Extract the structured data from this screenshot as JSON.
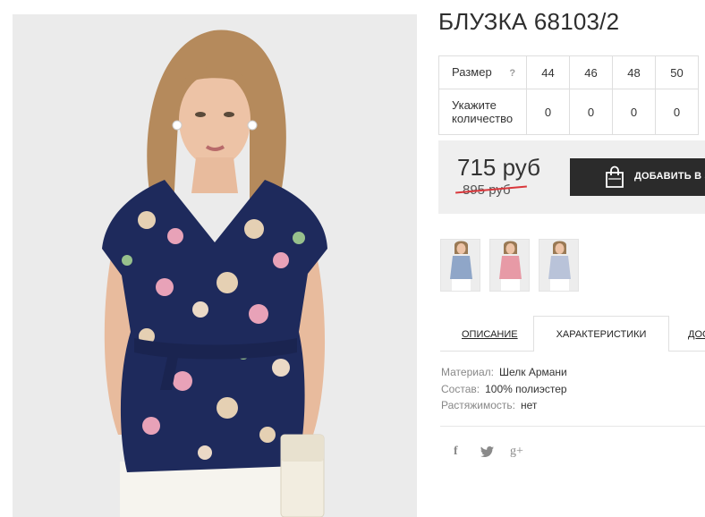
{
  "product": {
    "title": "БЛУЗКА 68103/2"
  },
  "size_table": {
    "size_label": "Размер",
    "help_glyph": "?",
    "sizes": [
      "44",
      "46",
      "48",
      "50"
    ],
    "qty_label_line1": "Укажите",
    "qty_label_line2": "количество",
    "quantities": [
      "0",
      "0",
      "0",
      "0"
    ]
  },
  "pricing": {
    "price": "715 руб",
    "old_price": "895 руб",
    "add_to_cart_label": "ДОБАВИТЬ В З",
    "strike_color": "#d9373b"
  },
  "gallery": {
    "thumbnails": [
      "photo-1",
      "photo-2",
      "photo-3"
    ]
  },
  "tabs": {
    "items": [
      "ОПИСАНИЕ",
      "ХАРАКТЕРИСТИКИ",
      "ДОС"
    ],
    "active": "ХАРАКТЕРИСТИКИ"
  },
  "specs": [
    {
      "key": "Материал:",
      "value": "Шелк Армани"
    },
    {
      "key": "Состав:",
      "value": "100% полиэстер"
    },
    {
      "key": "Растяжимость:",
      "value": "нет"
    }
  ],
  "social": {
    "facebook_glyph": "f",
    "twitter_glyph": "t",
    "google_glyph": "g+"
  },
  "icons": {
    "cart": "shopping-bag-icon",
    "facebook": "facebook-icon",
    "twitter": "twitter-icon",
    "google": "google-plus-icon"
  },
  "colors": {
    "button_bg": "#2b2b2b",
    "price_box_bg": "#efefef",
    "blouse": "#1e2a5c"
  }
}
